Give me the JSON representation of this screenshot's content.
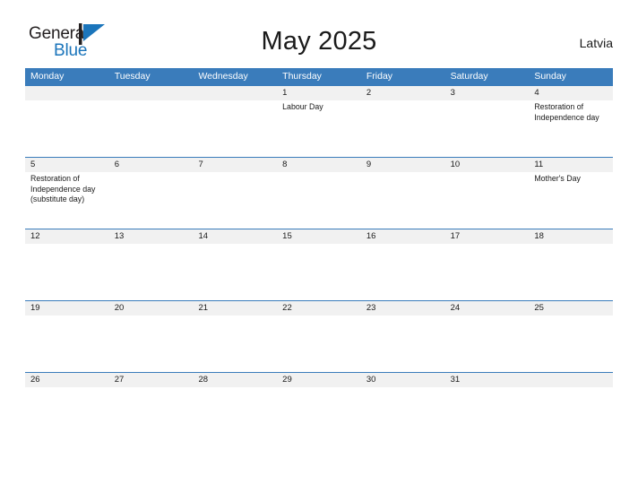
{
  "logo": {
    "word_1": "General",
    "word_2": "Blue",
    "mark_name": "blue-triangle-flag",
    "color_dark": "#231f20",
    "color_blue": "#1b75bb"
  },
  "header": {
    "title": "May 2025",
    "country": "Latvia"
  },
  "theme": {
    "header_blue": "#3a7cbb",
    "daynum_band_gray": "#f1f1f1",
    "separator_blue": "#3a7cbb",
    "text_color": "#1a1a1a",
    "page_background": "#ffffff"
  },
  "calendar": {
    "weekdays": [
      "Monday",
      "Tuesday",
      "Wednesday",
      "Thursday",
      "Friday",
      "Saturday",
      "Sunday"
    ],
    "weeks": [
      {
        "days": [
          {
            "number": "",
            "events": ""
          },
          {
            "number": "",
            "events": ""
          },
          {
            "number": "",
            "events": ""
          },
          {
            "number": "1",
            "events": "Labour Day"
          },
          {
            "number": "2",
            "events": ""
          },
          {
            "number": "3",
            "events": ""
          },
          {
            "number": "4",
            "events": "Restoration of Independence day"
          }
        ]
      },
      {
        "days": [
          {
            "number": "5",
            "events": "Restoration of Independence day (substitute day)"
          },
          {
            "number": "6",
            "events": ""
          },
          {
            "number": "7",
            "events": ""
          },
          {
            "number": "8",
            "events": ""
          },
          {
            "number": "9",
            "events": ""
          },
          {
            "number": "10",
            "events": ""
          },
          {
            "number": "11",
            "events": "Mother's Day"
          }
        ]
      },
      {
        "days": [
          {
            "number": "12",
            "events": ""
          },
          {
            "number": "13",
            "events": ""
          },
          {
            "number": "14",
            "events": ""
          },
          {
            "number": "15",
            "events": ""
          },
          {
            "number": "16",
            "events": ""
          },
          {
            "number": "17",
            "events": ""
          },
          {
            "number": "18",
            "events": ""
          }
        ]
      },
      {
        "days": [
          {
            "number": "19",
            "events": ""
          },
          {
            "number": "20",
            "events": ""
          },
          {
            "number": "21",
            "events": ""
          },
          {
            "number": "22",
            "events": ""
          },
          {
            "number": "23",
            "events": ""
          },
          {
            "number": "24",
            "events": ""
          },
          {
            "number": "25",
            "events": ""
          }
        ]
      },
      {
        "days": [
          {
            "number": "26",
            "events": ""
          },
          {
            "number": "27",
            "events": ""
          },
          {
            "number": "28",
            "events": ""
          },
          {
            "number": "29",
            "events": ""
          },
          {
            "number": "30",
            "events": ""
          },
          {
            "number": "31",
            "events": ""
          },
          {
            "number": "",
            "events": ""
          }
        ]
      }
    ]
  }
}
